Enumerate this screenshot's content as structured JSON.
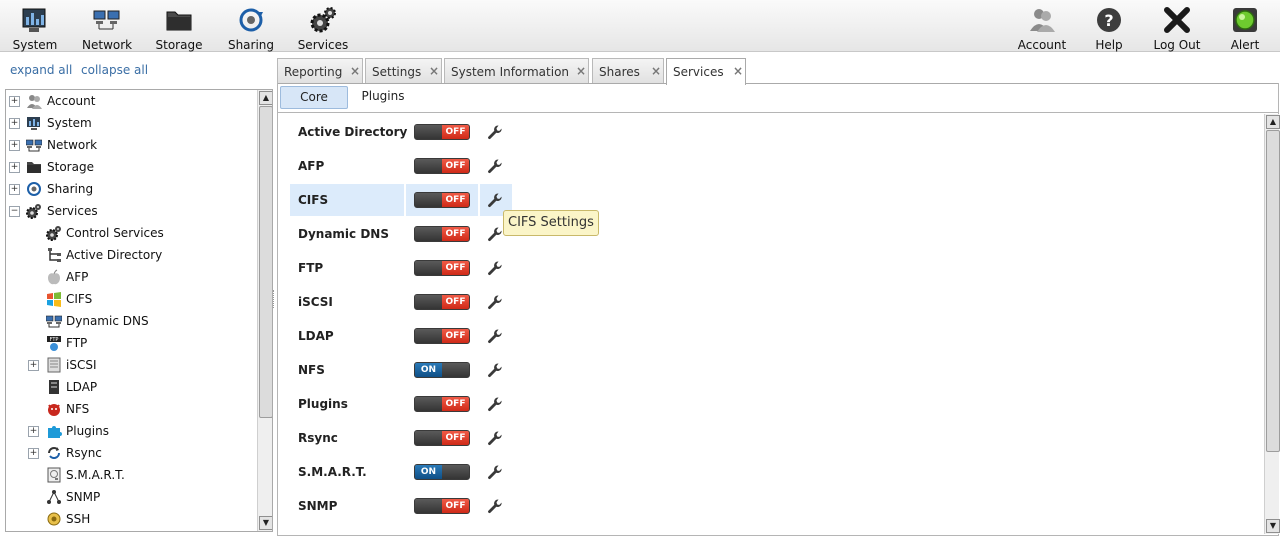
{
  "toolbar": {
    "system": "System",
    "network": "Network",
    "storage": "Storage",
    "sharing": "Sharing",
    "services": "Services",
    "account": "Account",
    "help": "Help",
    "logout": "Log Out",
    "alert": "Alert"
  },
  "sidebar": {
    "expand_all": "expand all",
    "collapse_all": "collapse all",
    "tree": [
      {
        "label": "Account",
        "expander": "+",
        "icon": "users-icon"
      },
      {
        "label": "System",
        "expander": "+",
        "icon": "system-monitor-icon"
      },
      {
        "label": "Network",
        "expander": "+",
        "icon": "network-icon"
      },
      {
        "label": "Storage",
        "expander": "+",
        "icon": "folder-icon"
      },
      {
        "label": "Sharing",
        "expander": "+",
        "icon": "sharing-icon"
      },
      {
        "label": "Services",
        "expander": "−",
        "icon": "gears-icon"
      },
      {
        "label": "Control Services",
        "icon": "gears-icon"
      },
      {
        "label": "Active Directory",
        "icon": "directory-tree-icon"
      },
      {
        "label": "AFP",
        "icon": "apple-icon"
      },
      {
        "label": "CIFS",
        "icon": "windows-icon"
      },
      {
        "label": "Dynamic DNS",
        "icon": "network-icon"
      },
      {
        "label": "FTP",
        "icon": "ftp-icon"
      },
      {
        "label": "iSCSI",
        "expander": "+",
        "icon": "iscsi-icon"
      },
      {
        "label": "LDAP",
        "icon": "server-icon"
      },
      {
        "label": "NFS",
        "icon": "nfs-daemon-icon"
      },
      {
        "label": "Plugins",
        "expander": "+",
        "icon": "puzzle-icon"
      },
      {
        "label": "Rsync",
        "expander": "+",
        "icon": "sync-icon"
      },
      {
        "label": "S.M.A.R.T.",
        "icon": "disk-icon"
      },
      {
        "label": "SNMP",
        "icon": "snmp-icon"
      },
      {
        "label": "SSH",
        "icon": "ssh-icon"
      }
    ]
  },
  "tabs": [
    {
      "label": "Reporting"
    },
    {
      "label": "Settings"
    },
    {
      "label": "System Information"
    },
    {
      "label": "Shares"
    },
    {
      "label": "Services",
      "active": true
    }
  ],
  "subtabs": {
    "core": "Core",
    "plugins": "Plugins"
  },
  "services": [
    {
      "name": "Active Directory",
      "state": "OFF"
    },
    {
      "name": "AFP",
      "state": "OFF"
    },
    {
      "name": "CIFS",
      "state": "OFF"
    },
    {
      "name": "Dynamic DNS",
      "state": "OFF"
    },
    {
      "name": "FTP",
      "state": "OFF"
    },
    {
      "name": "iSCSI",
      "state": "OFF"
    },
    {
      "name": "LDAP",
      "state": "OFF"
    },
    {
      "name": "NFS",
      "state": "ON"
    },
    {
      "name": "Plugins",
      "state": "OFF"
    },
    {
      "name": "Rsync",
      "state": "OFF"
    },
    {
      "name": "S.M.A.R.T.",
      "state": "ON"
    },
    {
      "name": "SNMP",
      "state": "OFF"
    }
  ],
  "tooltip": "CIFS Settings",
  "colors": {
    "off": "#d9301c",
    "on": "#145a95",
    "highlight": "#dcebfb",
    "link": "#3a6ea5"
  }
}
